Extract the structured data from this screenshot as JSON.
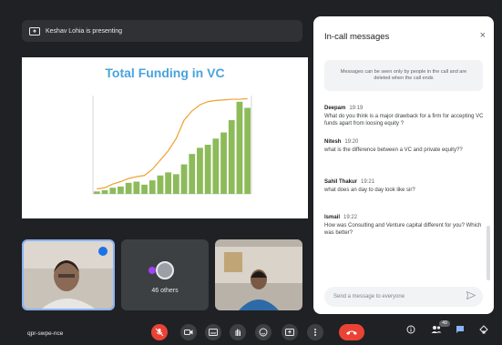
{
  "presenter": {
    "text": "Keshav Lohia is presenting"
  },
  "slide": {
    "chart_data": {
      "type": "bar",
      "title": "Total Funding in VC",
      "series": [
        {
          "name": "",
          "values": [
            0.4,
            0.6,
            1.0,
            1.2,
            1.8,
            2.0,
            1.5,
            2.2,
            3.0,
            3.5,
            3.2,
            4.8,
            6.5,
            7.5,
            8.0,
            9.0,
            10.0,
            12.0,
            15.0,
            14.0
          ]
        }
      ],
      "line": [
        0.8,
        1.0,
        1.6,
        2.0,
        2.5,
        2.8,
        3.0,
        4.0,
        5.5,
        7.0,
        9.0,
        12.0,
        13.5,
        14.5,
        15.0,
        15.2,
        15.3,
        15.4,
        15.4,
        15.5
      ],
      "ylim": [
        0,
        16
      ],
      "bar_color": "#8dbb5a",
      "line_color": "#f0a030"
    }
  },
  "tiles": {
    "others_label": "46 others"
  },
  "controls": {
    "meeting_code": "qpr-swpe-nce"
  },
  "chat": {
    "title": "In-call messages",
    "close": "×",
    "notice": "Messages can be seen only by people in the call and are deleted when the call ends",
    "messages": [
      {
        "sender": "Deepam",
        "time": "19:19",
        "text": "What do you think is a major drawback for a firm for accepting VC funds apart from loosing equity ?"
      },
      {
        "sender": "Nitesh",
        "time": "19:20",
        "text": "what is the difference between a VC and private equity??"
      },
      {
        "sender": "Sahil Thakur",
        "time": "19:21",
        "text": "what does an day to day look like sir?"
      },
      {
        "sender": "Ismail",
        "time": "19:22",
        "text": "How was Consulting and Venture capital different for you? Which was better?"
      }
    ],
    "input_placeholder": "Send a message to everyone"
  },
  "participants_badge": "49",
  "colors": {
    "accent": "#8ab4f8",
    "danger": "#ea4335",
    "bg": "#202124"
  }
}
